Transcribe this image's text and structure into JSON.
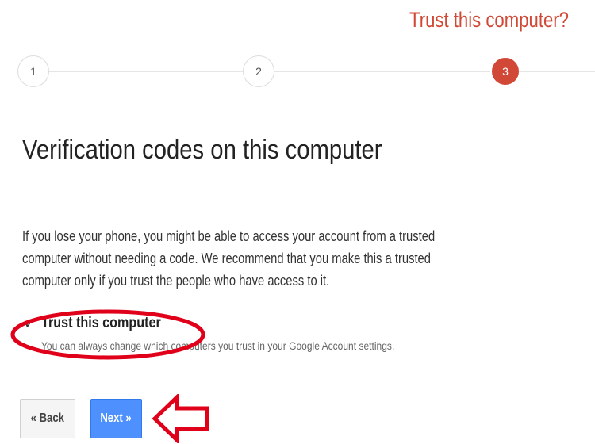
{
  "header": {
    "step_title": "Trust this computer?"
  },
  "stepper": {
    "steps": [
      {
        "label": "1",
        "active": false
      },
      {
        "label": "2",
        "active": false
      },
      {
        "label": "3",
        "active": true
      }
    ]
  },
  "main": {
    "title": "Verification codes on this computer",
    "description_lines": [
      "If you lose your phone, you might be able to access your account from a trusted",
      "computer without needing a code. We recommend that you make this a trusted",
      "computer only if you trust the people who have access to it."
    ],
    "trust_checkbox": {
      "checked": true,
      "check_glyph": "✓",
      "label": "Trust this computer",
      "hint": "You can always change which computers you trust in your Google Account settings."
    }
  },
  "actions": {
    "back_label": "« Back",
    "next_label": "Next »"
  },
  "colors": {
    "accent_red": "#d14836",
    "primary_blue": "#4d90fe",
    "annotation_red": "#e0001a"
  },
  "icons": {
    "checkbox": "check-icon",
    "annotation": "red-arrow-left-icon"
  }
}
